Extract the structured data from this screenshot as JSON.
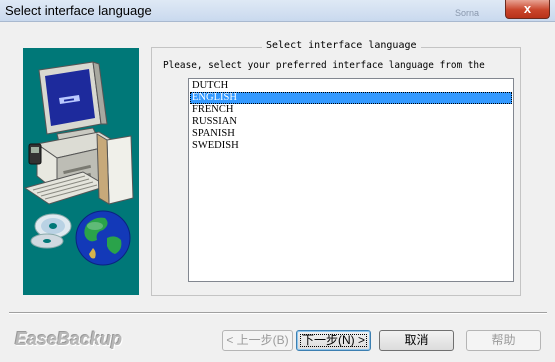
{
  "window": {
    "title": "Select interface language",
    "background_ghost_text": "Sorna",
    "close_glyph": "x"
  },
  "artwork": {
    "panel_color": "#007878",
    "icons": [
      "computer-icon",
      "cd-icon",
      "globe-icon"
    ]
  },
  "group": {
    "legend": "Select interface language",
    "prompt": "Please, select your preferred interface language from the"
  },
  "languages": {
    "items": [
      "DUTCH",
      "ENGLISH",
      "FRENCH",
      "RUSSIAN",
      "SPANISH",
      "SWEDISH"
    ],
    "selected": "ENGLISH",
    "selection_color": "#3399ff"
  },
  "footer": {
    "brand": "EaseBackup",
    "buttons": {
      "back": "< 上一步(B)",
      "next": "下一步(N) >",
      "cancel": "取消",
      "help": "帮助"
    }
  }
}
